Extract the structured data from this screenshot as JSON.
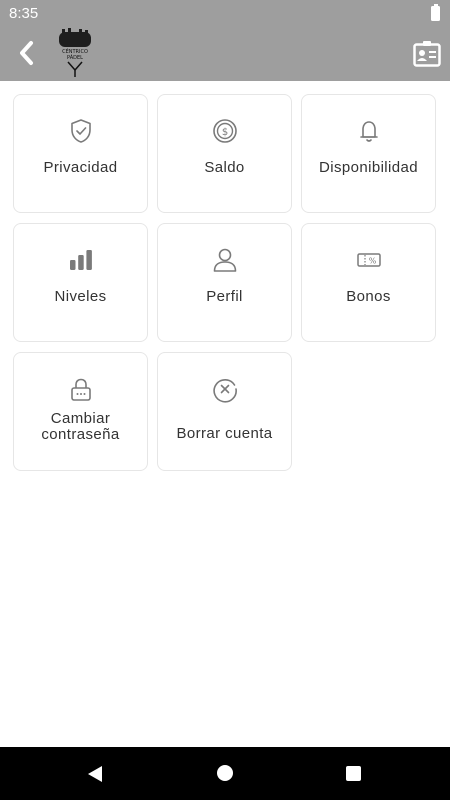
{
  "status_bar": {
    "time": "8:35"
  },
  "app_bar": {
    "logo_text_top": "CÉNTRICO",
    "logo_text_bottom": "PÁDEL"
  },
  "menu": {
    "items": [
      {
        "label": "Privacidad",
        "icon": "shield-check-icon"
      },
      {
        "label": "Saldo",
        "icon": "coin-icon"
      },
      {
        "label": "Disponibilidad",
        "icon": "bell-icon"
      },
      {
        "label": "Niveles",
        "icon": "bar-chart-icon"
      },
      {
        "label": "Perfil",
        "icon": "user-icon"
      },
      {
        "label": "Bonos",
        "icon": "voucher-icon"
      },
      {
        "label": "Cambiar contraseña",
        "icon": "lock-icon"
      },
      {
        "label": "Borrar cuenta",
        "icon": "delete-circle-icon"
      }
    ]
  },
  "colors": {
    "app_bar": "#9e9e9e",
    "icon": "#7a7a7a",
    "text": "#333333",
    "card_border": "#e6e6e6",
    "nav_bar": "#000000"
  }
}
